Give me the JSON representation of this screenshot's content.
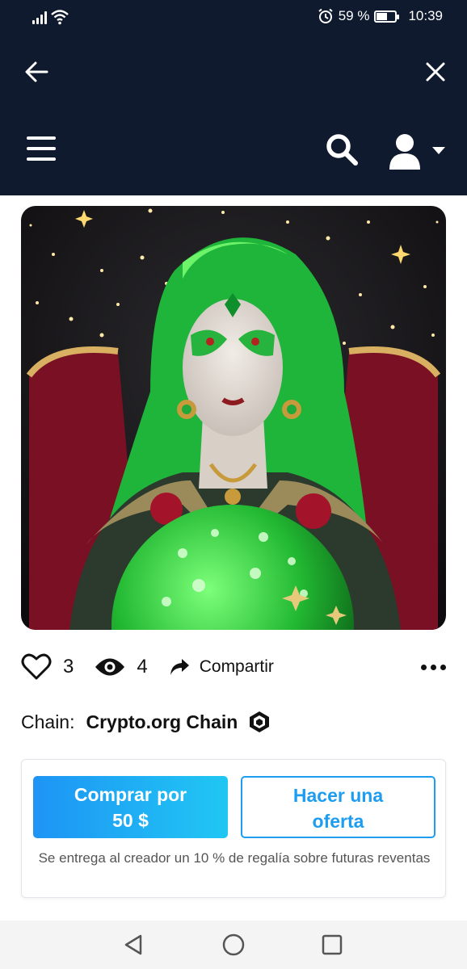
{
  "status_bar": {
    "battery": "59 %",
    "battery_level": 0.59,
    "time": "10:39"
  },
  "top_bar": {
    "back_icon": "arrow-left-icon",
    "close_icon": "close-icon"
  },
  "nav_bar": {
    "menu_icon": "hamburger-icon",
    "search_icon": "search-icon",
    "user_icon": "user-icon"
  },
  "artwork": {
    "description_icon": "artwork-image"
  },
  "actions": {
    "likes": "3",
    "views": "4",
    "share_label": "Compartir"
  },
  "chain": {
    "label": "Chain:",
    "name": "Crypto.org Chain"
  },
  "purchase": {
    "buy_line1": "Comprar por",
    "buy_line2": "50 $",
    "offer_line1": "Hacer una",
    "offer_line2": "oferta",
    "royalty_note": "Se entrega al creador un 10 % de regalía sobre futuras reventas"
  },
  "colors": {
    "header_bg": "#0f1a2e",
    "accent": "#1e9cf0"
  }
}
